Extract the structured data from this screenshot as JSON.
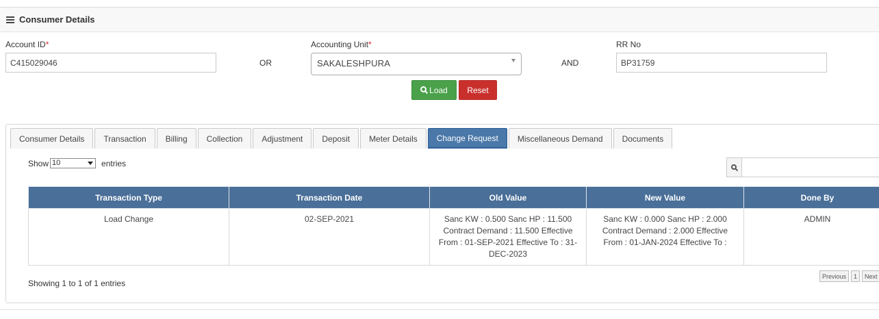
{
  "panel": {
    "title": "Consumer Details"
  },
  "form": {
    "account_id_label": "Account ID",
    "account_id_value": "C415029046",
    "or_text": "OR",
    "accounting_unit_label": "Accounting Unit",
    "accounting_unit_value": "SAKALESHPURA",
    "and_text": "AND",
    "rr_no_label": "RR No",
    "rr_no_value": "BP31759",
    "required_mark": "*",
    "load_label": "Load",
    "reset_label": "Reset"
  },
  "tabs": [
    {
      "label": "Consumer Details"
    },
    {
      "label": "Transaction"
    },
    {
      "label": "Billing"
    },
    {
      "label": "Collection"
    },
    {
      "label": "Adjustment"
    },
    {
      "label": "Deposit"
    },
    {
      "label": "Meter Details"
    },
    {
      "label": "Change Request",
      "active": true
    },
    {
      "label": "Miscellaneous Demand"
    },
    {
      "label": "Documents"
    }
  ],
  "table_controls": {
    "show_label": "Show",
    "page_size": "10",
    "entries_label": "entries"
  },
  "table": {
    "columns": [
      "Transaction Type",
      "Transaction Date",
      "Old Value",
      "New Value",
      "Done By"
    ],
    "rows": [
      {
        "transaction_type": "Load Change",
        "transaction_date": "02-SEP-2021",
        "old_value": "Sanc KW : 0.500 Sanc HP : 11.500 Contract Demand : 11.500 Effective From : 01-SEP-2021 Effective To : 31-DEC-2023",
        "new_value": "Sanc KW : 0.000 Sanc HP : 2.000 Contract Demand : 2.000 Effective From : 01-JAN-2024 Effective To :",
        "done_by": "ADMIN"
      }
    ]
  },
  "footer": {
    "showing_text": "Showing 1 to 1 of 1 entries",
    "previous_label": "Previous",
    "page_number": "1",
    "next_label": "Next"
  },
  "colors": {
    "header_bg": "#4a6f98",
    "active_tab": "#4a78a8",
    "load_button": "#4aa14a",
    "reset_button": "#c9302c"
  },
  "icons": [
    "hamburger-icon",
    "search-icon",
    "select-arrow-icon"
  ]
}
